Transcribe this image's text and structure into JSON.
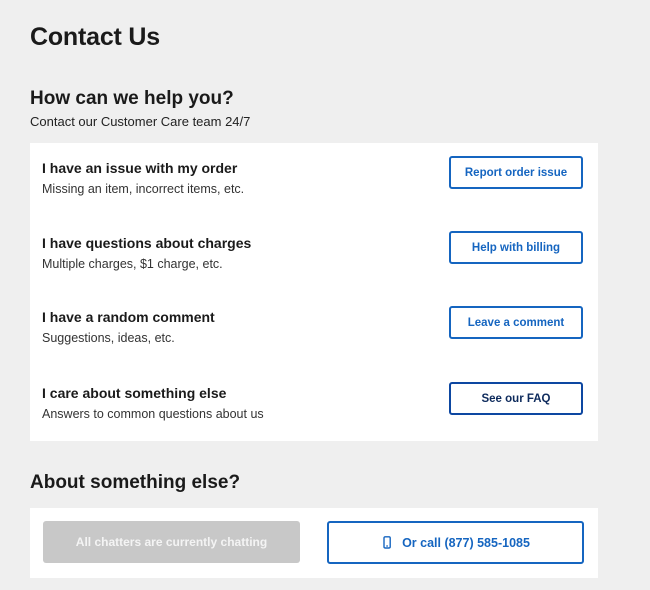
{
  "page": {
    "title": "Contact Us"
  },
  "help": {
    "heading": "How can we help you?",
    "subheading": "Contact our Customer Care team 24/7",
    "options": [
      {
        "title": "I have an issue with my order",
        "description": "Missing an item, incorrect items, etc.",
        "button_label": "Report order issue"
      },
      {
        "title": "I have questions about charges",
        "description": "Multiple charges, $1 charge, etc.",
        "button_label": "Help with billing"
      },
      {
        "title": "I have a random comment",
        "description": "Suggestions, ideas, etc.",
        "button_label": "Leave a comment"
      },
      {
        "title": "I care about something else",
        "description": "Answers to common questions about us",
        "button_label": "See our FAQ"
      }
    ]
  },
  "else_section": {
    "heading": "About something else?",
    "chat_button_label": "All chatters are currently chatting",
    "chat_button_state": "disabled",
    "call_button_label": "Or call (877) 585-1085",
    "call_icon": "phone-icon"
  },
  "colors": {
    "accent": "#1565c0",
    "background": "#efefef",
    "card": "#ffffff",
    "disabled": "#c8c8c8"
  }
}
